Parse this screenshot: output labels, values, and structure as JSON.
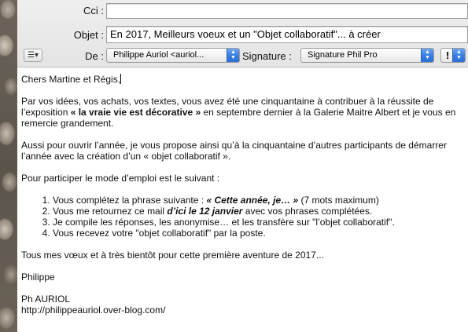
{
  "header": {
    "cci_label": "Cci :",
    "cci_value": "",
    "objet_label": "Objet :",
    "objet_value": "En 2017, Meilleurs voeux et un \"Objet collaboratif\"... à créer",
    "de_label": "De :",
    "de_value": "Philippe Auriol <auriol...",
    "signature_label": "Signature :",
    "signature_value": "Signature Phil Pro",
    "priority_label": "!",
    "menu_icon_label": "☰▾"
  },
  "body": {
    "greeting": "Chers Martine et Régis,",
    "p1_a": "Par vos idées, vos achats, vos textes, vous avez été une cinquantaine à contribuer à la réussite de l’exposition ",
    "p1_bold": "« la vraie vie est décorative »",
    "p1_b": " en septembre dernier à la Galerie Maitre Albert et  je vous en remercie grandement.",
    "p2": "Aussi pour ouvrir l’année, je vous propose ainsi qu’à la cinquantaine d’autres participants de démarrer l’année avec la création d’un « objet collaboratif ».",
    "p3": "Pour participer le mode d’emploi est le suivant :",
    "list": {
      "item1_a": "Vous complétez la phrase suivante : ",
      "item1_bold": "« Cette année, je… »",
      "item1_b": " (7 mots maximum)",
      "item2_a": "Vous me retournez ce mail ",
      "item2_bold": "d’ici le 12 janvier",
      "item2_b": " avec vos phrases complétées.",
      "item3": "Je compile les réponses, les anonymise… et les transfère sur \"l’objet collaboratif\".",
      "item4": "Vous recevez votre \"objet collaboratif\" par la poste."
    },
    "p4": "Tous mes vœux et à très bientôt pour cette première aventure de 2017...",
    "sign1": "Philippe",
    "sign2": "Ph AURIOL",
    "sign_link": "http://philippeauriol.over-blog.com/"
  },
  "colors": {
    "popup_accent": "#3a7fe0",
    "header_bg": "#e9e9e9"
  },
  "icons": {
    "menu": "action-menu-icon",
    "popup": "updown-arrows-icon"
  }
}
